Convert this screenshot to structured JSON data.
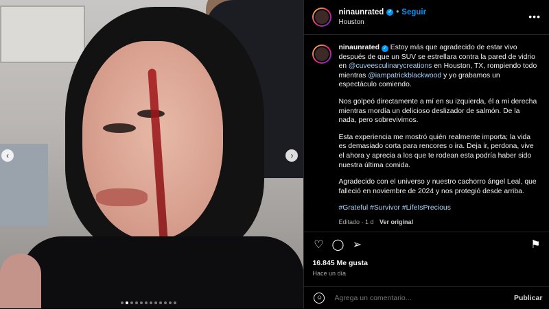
{
  "post": {
    "username": "ninaunrated",
    "follow_label": "Seguir",
    "separator": "•",
    "location": "Houston",
    "more_label": "•••"
  },
  "caption": {
    "p1_pre": "Estoy más que agradecido de estar vivo después de que un SUV se estrellara contra la pared de vidrio en ",
    "mention1": "@cuveesculinarycreations",
    "p1_mid": " en Houston, TX, rompiendo todo mientras ",
    "mention2": "@iampatrickblackwood",
    "p1_post": " y yo grabamos un espectáculo comiendo.",
    "p2": "Nos golpeó directamente a mí en su izquierda, él a mi derecha mientras mordía un delicioso deslizador de salmón. De la nada, pero sobrevivimos.",
    "p3": "Esta experiencia me mostró quién realmente importa; la vida es demasiado corta para rencores o ira. Deja ir, perdona, vive el ahora y aprecia a los que te rodean esta podría haber sido nuestra última comida.",
    "p4": "Agradecido con el universo y nuestro cachorro ángel Leal, que falleció en noviembre de 2024 y nos protegió desde arriba.",
    "hashtags": "#Grateful #Survivor #LifeIsPrecious",
    "edited": "Editado · 1 d",
    "see_original": "Ver original"
  },
  "stats": {
    "likes": "16.845 Me gusta",
    "time_ago": "Hace un día"
  },
  "comment": {
    "placeholder": "Agrega un comentario...",
    "publish_label": "Publicar"
  },
  "icons": {
    "like": "heart-icon",
    "comment": "comment-icon",
    "share": "share-icon",
    "save": "bookmark-icon"
  },
  "carousel": {
    "dot_count": 12,
    "active_index": 1
  },
  "colors": {
    "accent": "#0095f6",
    "background": "#000000",
    "mention": "#a7d4ff"
  }
}
